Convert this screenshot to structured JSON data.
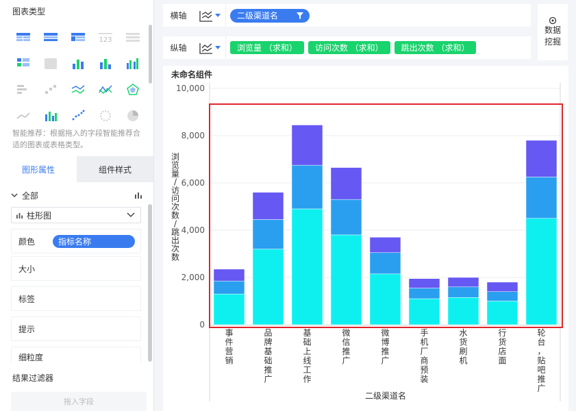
{
  "left_panel": {
    "chart_type_title": "图表类型",
    "smart_tip": "智能推荐：根据拖入的字段智能推荐合适的图表或表格类型。",
    "tabs": [
      "图形属性",
      "组件样式"
    ],
    "all_label": "全部",
    "chart_type_select": "柱形图",
    "props": {
      "color": "颜色",
      "color_value": "指标名称",
      "size": "大小",
      "label": "标签",
      "tooltip": "提示",
      "granularity": "细粒度"
    },
    "filter_title": "结果过滤器",
    "drop_placeholder": "拖入字段"
  },
  "axes": {
    "x_label": "横轴",
    "x_field": "二级渠道名",
    "y_label": "纵轴",
    "y_fields": [
      "浏览量 （求和）",
      "访问次数 （求和）",
      "跳出次数 （求和）"
    ]
  },
  "mining_button": [
    "数据",
    "挖掘"
  ],
  "component_title": "未命名组件",
  "colors": {
    "accent": "#3a7cf0",
    "green": "#19d36c",
    "s1": "#0ef0f0",
    "s2": "#2a9ff0",
    "s3": "#6658f2",
    "selection": "#e0252a"
  },
  "chart_data": {
    "type": "bar",
    "stacked": true,
    "categories": [
      "事件营销",
      "品牌基础推广",
      "基础上线工作",
      "微信推广",
      "微博推广",
      "手机厂商预装",
      "水货刷机",
      "行货店面",
      "轮台，贴吧推广"
    ],
    "series": [
      {
        "values": [
          1300,
          3200,
          4900,
          3800,
          2150,
          1100,
          1150,
          1000,
          4500
        ]
      },
      {
        "values": [
          550,
          1250,
          1850,
          1500,
          900,
          450,
          450,
          400,
          1750
        ]
      },
      {
        "values": [
          500,
          1150,
          1700,
          1350,
          650,
          400,
          400,
          400,
          1550
        ]
      }
    ],
    "ylabel": "浏览量/访问次数/跳出次数",
    "xlabel": "二级渠道名",
    "ylim": [
      0,
      10000
    ],
    "yticks": [
      "0",
      "2,000",
      "4,000",
      "6,000",
      "8,000",
      "10,000"
    ],
    "grid": true
  }
}
